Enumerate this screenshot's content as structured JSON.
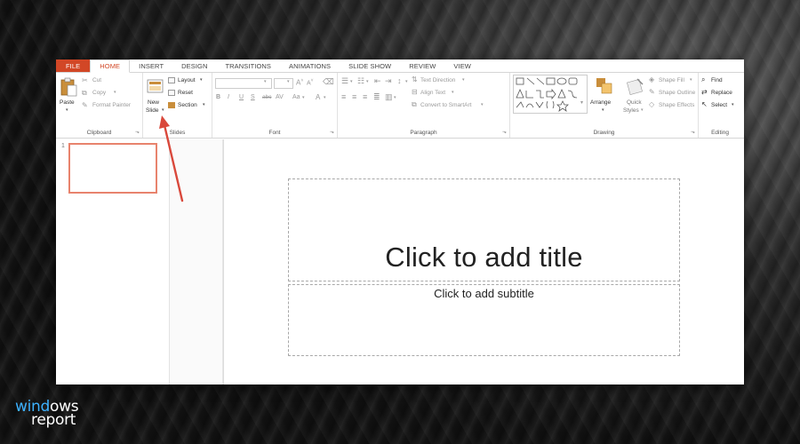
{
  "colors": {
    "accent": "#d24726",
    "arrow": "#d9483b",
    "logo_accent": "#3db2ff"
  },
  "tabs": [
    "FILE",
    "HOME",
    "INSERT",
    "DESIGN",
    "TRANSITIONS",
    "ANIMATIONS",
    "SLIDE SHOW",
    "REVIEW",
    "VIEW"
  ],
  "active_tab": "HOME",
  "clipboard": {
    "paste": "Paste",
    "cut": "Cut",
    "copy": "Copy",
    "format_painter": "Format Painter",
    "label": "Clipboard"
  },
  "slides": {
    "new_slide_1": "New",
    "new_slide_2": "Slide",
    "layout": "Layout",
    "reset": "Reset",
    "section": "Section",
    "label": "Slides"
  },
  "font": {
    "bold": "B",
    "italic": "I",
    "underline": "U",
    "strike": "S",
    "abc": "abc",
    "aa": "Aa",
    "a": "A",
    "label": "Font"
  },
  "paragraph": {
    "text_direction": "Text Direction",
    "align_text": "Align Text",
    "convert_smartart": "Convert to SmartArt",
    "label": "Paragraph"
  },
  "drawing": {
    "arrange": "Arrange",
    "quick_styles_1": "Quick",
    "quick_styles_2": "Styles",
    "shape_fill": "Shape Fill",
    "shape_outline": "Shape Outline",
    "shape_effects": "Shape Effects",
    "label": "Drawing"
  },
  "editing": {
    "find": "Find",
    "replace": "Replace",
    "select": "Select",
    "label": "Editing"
  },
  "thumbnails": {
    "slide_number": "1"
  },
  "slide": {
    "title_placeholder": "Click to add title",
    "subtitle_placeholder": "Click to add subtitle"
  },
  "logo": {
    "line1_a": "wind",
    "line1_b": "ows",
    "line2": "report"
  }
}
